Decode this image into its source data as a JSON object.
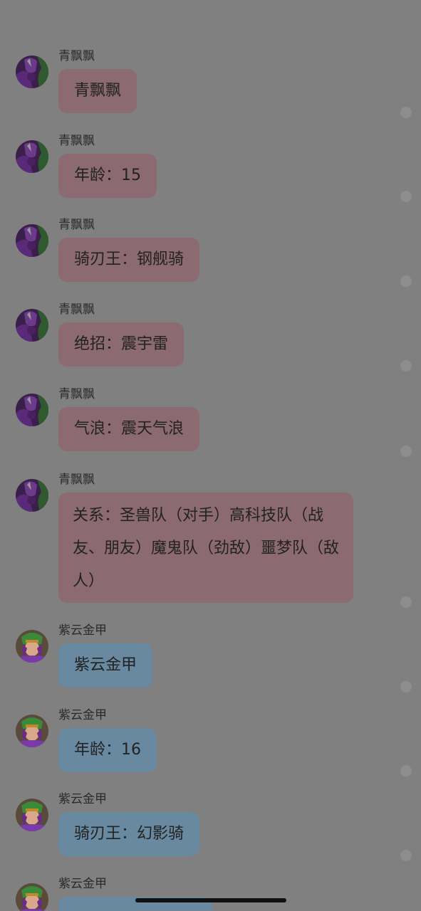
{
  "messages": [
    {
      "sender": "青飘飘",
      "text": "青飘飘",
      "color": "#8b6a72"
    },
    {
      "sender": "青飘飘",
      "text": "年龄：15",
      "color": "#8b6a72"
    },
    {
      "sender": "青飘飘",
      "text": "骑刃王：钢舰骑",
      "color": "#8b6a72"
    },
    {
      "sender": "青飘飘",
      "text": "绝招：震宇雷",
      "color": "#8b6a72"
    },
    {
      "sender": "青飘飘",
      "text": "气浪：震天气浪",
      "color": "#8b6a72"
    },
    {
      "sender": "青飘飘",
      "text": "关系：圣兽队（对手）高科技队（战友、朋友）魔鬼队（劲敌）噩梦队（敌人）",
      "color": "#8b6a72"
    },
    {
      "sender": "紫云金甲",
      "text": "紫云金甲",
      "color": "#6889a0"
    },
    {
      "sender": "紫云金甲",
      "text": "年龄：16",
      "color": "#6889a0"
    },
    {
      "sender": "紫云金甲",
      "text": "骑刃王：幻影骑",
      "color": "#6889a0"
    },
    {
      "sender": "紫云金甲",
      "text": "",
      "color": "#6889a0"
    }
  ]
}
